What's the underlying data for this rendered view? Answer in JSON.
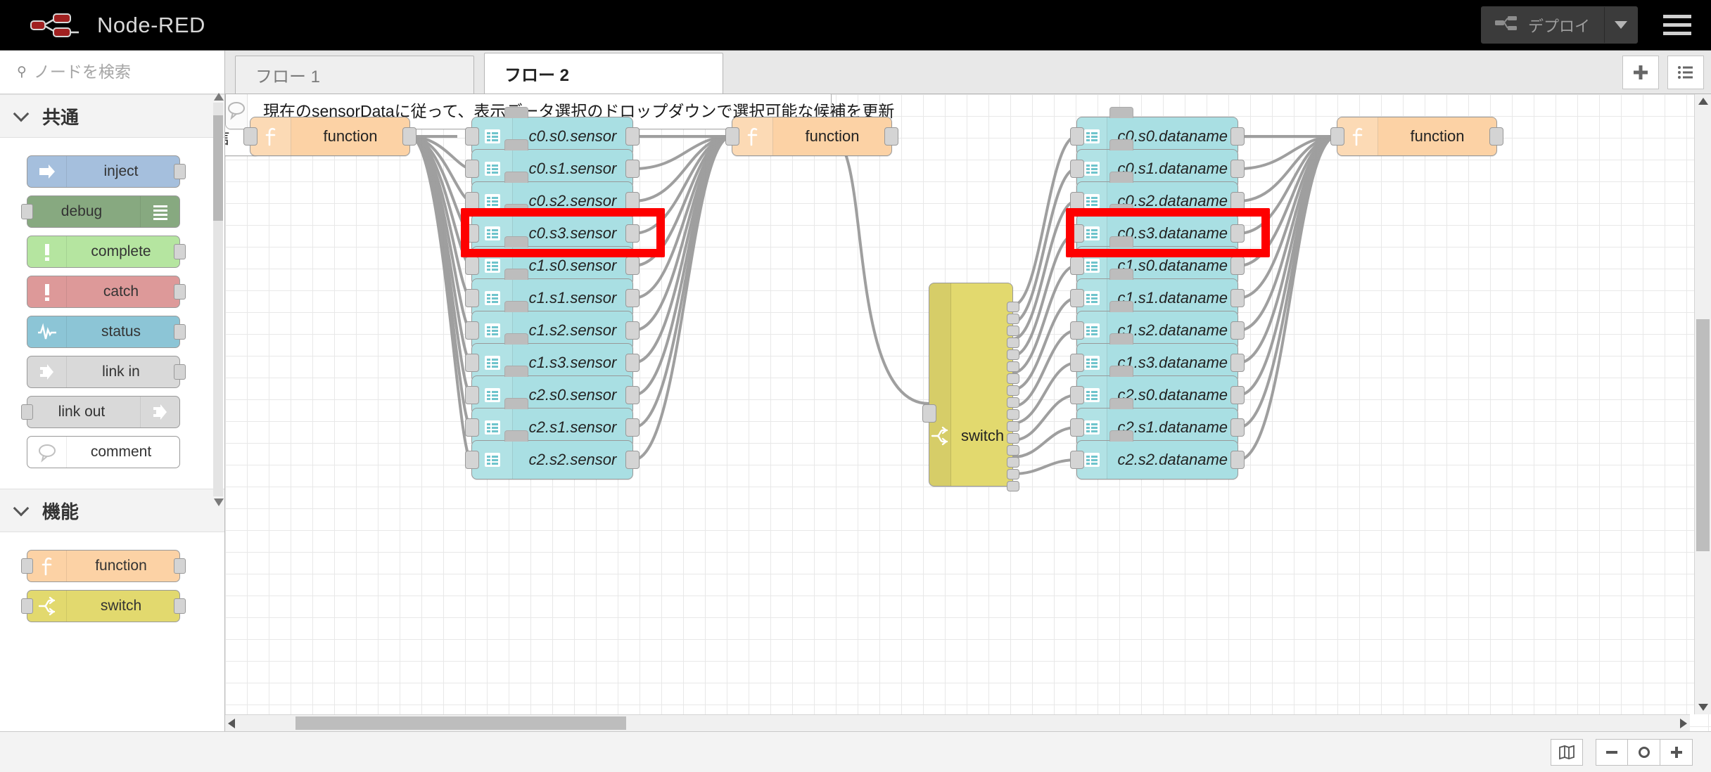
{
  "header": {
    "brand_title": "Node-RED",
    "logo_icon": "node-red-logo-icon",
    "deploy_label": "デプロイ",
    "deploy_icon": "deploy-icon",
    "deploy_caret_icon": "chevron-down-icon",
    "menu_icon": "hamburger-menu-icon"
  },
  "palette": {
    "search": {
      "placeholder": "ノードを検索",
      "value": "",
      "icon": "search-icon"
    },
    "categories": [
      {
        "label": "共通",
        "chevron_icon": "chevron-down-icon",
        "nodes": [
          {
            "label": "inject",
            "icon": "inject-arrow-icon",
            "color": "#a5bfdd",
            "icon_side": "left",
            "in": false,
            "out": true
          },
          {
            "label": "debug",
            "icon": "debug-lines-icon",
            "color": "#87a980",
            "icon_side": "right",
            "in": true,
            "out": false
          },
          {
            "label": "complete",
            "icon": "exclamation-icon",
            "color": "#b5e5a0",
            "icon_side": "left",
            "in": false,
            "out": true
          },
          {
            "label": "catch",
            "icon": "exclamation-icon",
            "color": "#dd9999",
            "icon_side": "left",
            "in": false,
            "out": true
          },
          {
            "label": "status",
            "icon": "pulse-wave-icon",
            "color": "#8cc5d6",
            "icon_side": "left",
            "in": false,
            "out": true
          },
          {
            "label": "link in",
            "icon": "link-in-icon",
            "color": "#d9d9d9",
            "icon_side": "left",
            "in": false,
            "out": true
          },
          {
            "label": "link out",
            "icon": "link-out-icon",
            "color": "#d9d9d9",
            "icon_side": "right",
            "in": true,
            "out": false
          },
          {
            "label": "comment",
            "icon": "comment-bubble-icon",
            "color": "#ffffff",
            "icon_side": "left",
            "in": false,
            "out": false
          }
        ]
      },
      {
        "label": "機能",
        "chevron_icon": "chevron-down-icon",
        "nodes": [
          {
            "label": "function",
            "icon": "function-f-icon",
            "color": "#fcd2a5",
            "icon_side": "left",
            "in": true,
            "out": true
          },
          {
            "label": "switch",
            "icon": "switch-fork-icon",
            "color": "#e2d96e",
            "icon_side": "left",
            "in": true,
            "out": true
          }
        ]
      }
    ],
    "footer": {
      "collapse_all_label": "»",
      "expand_all_label": "»",
      "collapse_icon": "chevrons-up-icon",
      "expand_icon": "chevrons-down-icon"
    },
    "scrollbar": {
      "up_icon": "scroll-up-arrow-icon",
      "down_icon": "scroll-down-arrow-icon"
    }
  },
  "tabbar": {
    "tabs": [
      {
        "label": "フロー 1",
        "active": false
      },
      {
        "label": "フロー 2",
        "active": true
      }
    ],
    "add_tab_icon": "plus-icon",
    "list_tabs_icon": "list-icon"
  },
  "canvas": {
    "comment": {
      "text": "現在のsensorDataに従って、表示データ選択のドロップダウンで選択可能な候補を更新",
      "icon": "comment-bubble-icon"
    },
    "clipped_node": {
      "label": "信"
    },
    "function_nodes": [
      {
        "label": "function",
        "icon": "function-f-icon"
      },
      {
        "label": "function",
        "icon": "function-f-icon"
      },
      {
        "label": "function",
        "icon": "function-f-icon"
      }
    ],
    "switch_node": {
      "label": "switch",
      "icon": "switch-fork-icon",
      "outputs": 16
    },
    "sensor_nodes": [
      "c0.s0.sensor",
      "c0.s1.sensor",
      "c0.s2.sensor",
      "c0.s3.sensor",
      "c1.s0.sensor",
      "c1.s1.sensor",
      "c1.s2.sensor",
      "c1.s3.sensor",
      "c2.s0.sensor",
      "c2.s1.sensor",
      "c2.s2.sensor"
    ],
    "dataname_nodes": [
      "c0.s0.dataname",
      "c0.s1.dataname",
      "c0.s2.dataname",
      "c0.s3.dataname",
      "c1.s0.dataname",
      "c1.s1.dataname",
      "c1.s2.dataname",
      "c1.s3.dataname",
      "c2.s0.dataname",
      "c2.s1.dataname",
      "c2.s2.dataname"
    ],
    "node_icon": "list-node-icon",
    "highlights": [
      {
        "target": "c0.s3.sensor",
        "color": "#fe0000"
      },
      {
        "target": "c0.s3.dataname",
        "color": "#fe0000"
      }
    ]
  },
  "bottombar": {
    "map_toggle_icon": "map-icon",
    "zoom_out_icon": "minus-icon",
    "zoom_reset_icon": "circle-icon",
    "zoom_in_icon": "plus-icon"
  },
  "colors": {
    "brand_red": "#a02020",
    "sensor_node": "#a9dfe3",
    "function_node": "#fcd2a5",
    "switch_node": "#e2d96e",
    "highlight": "#fe0000",
    "header_bg": "#000000"
  }
}
